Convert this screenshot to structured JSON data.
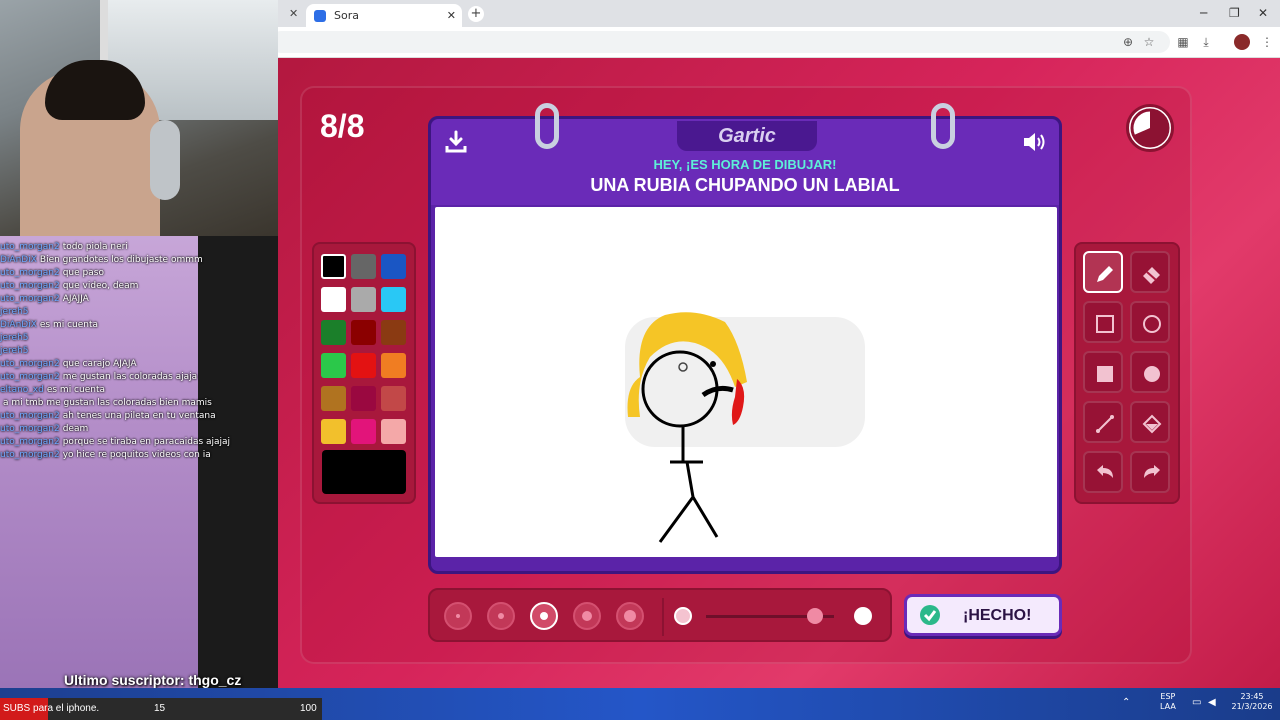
{
  "browser": {
    "tab_label": "Sora",
    "new_tab": "+"
  },
  "game": {
    "round": "8/8",
    "logo": "Gartic",
    "subtitle": "HEY, ¡ES HORA DE DIBUJAR!",
    "prompt": "UNA RUBIA CHUPANDO UN LABIAL",
    "done_label": "¡HECHO!",
    "palette": [
      "#000000",
      "#666666",
      "#1a56c4",
      "#ffffff",
      "#aaaaaa",
      "#29c8f5",
      "#1b7f2a",
      "#8b0000",
      "#8a3a12",
      "#2bc84a",
      "#e31212",
      "#f07d22",
      "#b07320",
      "#9a0840",
      "#c24848",
      "#f2c02c",
      "#e2147a",
      "#f4a8a8"
    ],
    "selected_color": "#000000",
    "tools": [
      "pencil",
      "eraser",
      "rectangle-outline",
      "circle-outline",
      "rectangle-filled",
      "circle-filled",
      "line",
      "fill-bucket",
      "undo",
      "redo"
    ],
    "selected_tool": "pencil",
    "brush_sizes": [
      1,
      2,
      3,
      4,
      5
    ],
    "selected_size": 3,
    "opacity": 0.85
  },
  "stream": {
    "chat": [
      {
        "user": "uto_morgan2",
        "msg": "todo piola neri"
      },
      {
        "user": "DiAnDiX",
        "msg": "Bien grandotes los dibujaste ommm"
      },
      {
        "user": "uto_morgan2",
        "msg": "que paso"
      },
      {
        "user": "uto_morgan2",
        "msg": "que video, deam"
      },
      {
        "user": "uto_morgan2",
        "msg": "AJAJJA"
      },
      {
        "user": "jereh5",
        "msg": ""
      },
      {
        "user": "DiAnDiX",
        "msg": "es mi cuenta"
      },
      {
        "user": "jereh5",
        "msg": ""
      },
      {
        "user": "jereh5",
        "msg": ""
      },
      {
        "user": "uto_morgan2",
        "msg": "que carajo AJAJA"
      },
      {
        "user": "uto_morgan2",
        "msg": "me gustan las coloradas ajaja"
      },
      {
        "user": "eltano_xd",
        "msg": "es mi cuenta"
      },
      {
        "user": "",
        "msg": "a mi tmb me gustan las coloradas bien mamis"
      },
      {
        "user": "uto_morgan2",
        "msg": "ah tenes una pileta en tu ventana"
      },
      {
        "user": "uto_morgan2",
        "msg": "deam"
      },
      {
        "user": "uto_morgan2",
        "msg": "porque se tiraba en paracaidas ajajaj"
      },
      {
        "user": "uto_morgan2",
        "msg": "yo hice re poquitos videos con ia"
      }
    ],
    "last_sub": "Ultimo suscriptor: thgo_cz",
    "subs_text": "SUBS para el iphone.",
    "subs_current": "15",
    "subs_goal": "100"
  },
  "taskbar": {
    "lang_top": "ESP",
    "lang_bottom": "LAA",
    "time": "23:45",
    "date": "21/3/2026"
  }
}
